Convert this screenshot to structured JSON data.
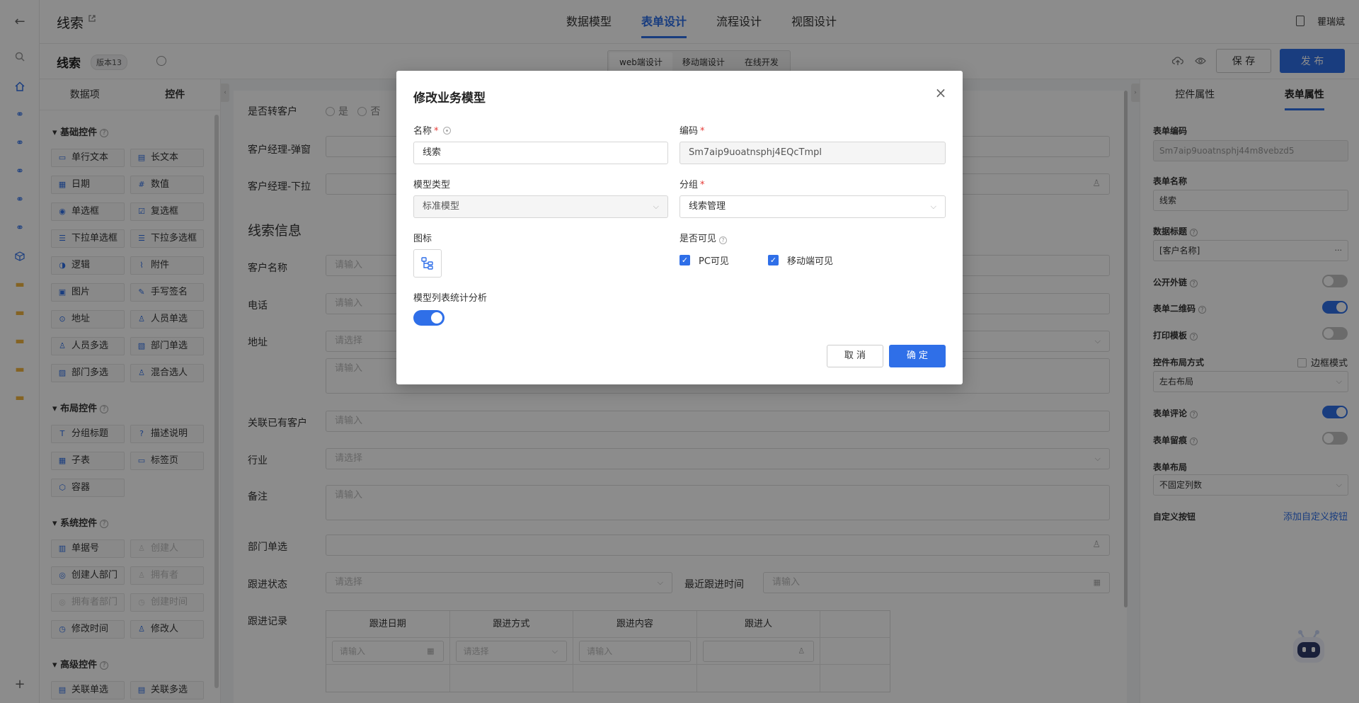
{
  "header": {
    "app_title": "线索",
    "main_tabs": [
      {
        "label": "数据模型"
      },
      {
        "label": "表单设计",
        "active": true
      },
      {
        "label": "流程设计"
      },
      {
        "label": "视图设计"
      }
    ],
    "user_name": "瞿瑞斌"
  },
  "toolbar": {
    "form_name": "线索",
    "version": "版本13",
    "segments": [
      {
        "label": "web端设计",
        "active": true
      },
      {
        "label": "移动端设计"
      },
      {
        "label": "在线开发"
      }
    ],
    "save_label": "保 存",
    "publish_label": "发 布"
  },
  "left_panel": {
    "tabs": [
      {
        "label": "数据项"
      },
      {
        "label": "控件",
        "active": true
      }
    ],
    "groups": [
      {
        "title": "基础控件",
        "items": [
          "单行文本",
          "长文本",
          "日期",
          "数值",
          "单选框",
          "复选框",
          "下拉单选框",
          "下拉多选框",
          "逻辑",
          "附件",
          "图片",
          "手写签名",
          "地址",
          "人员单选",
          "人员多选",
          "部门单选",
          "部门多选",
          "混合选人"
        ]
      },
      {
        "title": "布局控件",
        "items": [
          "分组标题",
          "描述说明",
          "子表",
          "标签页",
          "容器"
        ]
      },
      {
        "title": "系统控件",
        "items": [
          "单据号",
          "创建人",
          "创建人部门",
          "拥有者",
          "拥有者部门",
          "创建时间",
          "修改时间",
          "修改人"
        ]
      },
      {
        "title": "高级控件",
        "items": [
          "关联单选",
          "关联多选"
        ]
      }
    ]
  },
  "canvas": {
    "fields": {
      "convert_label": "是否转客户",
      "convert_yes": "是",
      "convert_no": "否",
      "manager_popup_label": "客户经理-弹窗",
      "manager_drop_label": "客户经理-下拉",
      "section_title": "线索信息",
      "customer_name_label": "客户名称",
      "phone_label": "电话",
      "address_label": "地址",
      "related_label": "关联已有客户",
      "industry_label": "行业",
      "remark_label": "备注",
      "dept_label": "部门单选",
      "follow_status_label": "跟进状态",
      "last_follow_label": "最近跟进时间",
      "follow_record_label": "跟进记录"
    },
    "placeholders": {
      "input": "请输入",
      "select": "请选择"
    },
    "sub_table": {
      "headers": [
        "跟进日期",
        "跟进方式",
        "跟进内容",
        "跟进人"
      ],
      "row_placeholders": [
        "请输入",
        "请选择",
        "请输入"
      ]
    }
  },
  "right_panel": {
    "tabs": [
      {
        "label": "控件属性"
      },
      {
        "label": "表单属性",
        "active": true
      }
    ],
    "form_code_label": "表单编码",
    "form_code_value": "Sm7aip9uoatnsphj44m8vebzd5",
    "form_name_label": "表单名称",
    "form_name_value": "线索",
    "data_title_label": "数据标题",
    "data_title_value": "[客户名称]",
    "public_link_label": "公开外链",
    "public_link_on": false,
    "qr_label": "表单二维码",
    "qr_on": true,
    "print_label": "打印模板",
    "print_on": false,
    "layout_mode_label": "控件布局方式",
    "border_mode_label": "边框模式",
    "layout_mode_value": "左右布局",
    "comment_label": "表单评论",
    "comment_on": true,
    "trace_label": "表单留痕",
    "trace_on": false,
    "form_layout_label": "表单布局",
    "form_layout_value": "不固定列数",
    "custom_btn_label": "自定义按钮",
    "custom_btn_link": "添加自定义按钮"
  },
  "modal": {
    "title": "修改业务模型",
    "name_label": "名称",
    "name_value": "线索",
    "code_label": "编码",
    "code_value": "Sm7aip9uoatnsphj4EQcTmpl",
    "model_type_label": "模型类型",
    "model_type_value": "标准模型",
    "group_label": "分组",
    "group_value": "线索管理",
    "icon_label": "图标",
    "visible_label": "是否可见",
    "pc_visible_label": "PC可见",
    "pc_visible": true,
    "mobile_visible_label": "移动端可见",
    "mobile_visible": true,
    "stats_label": "模型列表统计分析",
    "stats_on": true,
    "cancel_label": "取 消",
    "ok_label": "确 定"
  },
  "colors": {
    "accent": "#2f6fe8",
    "required": "#e53935",
    "folder": "#f0b440"
  }
}
